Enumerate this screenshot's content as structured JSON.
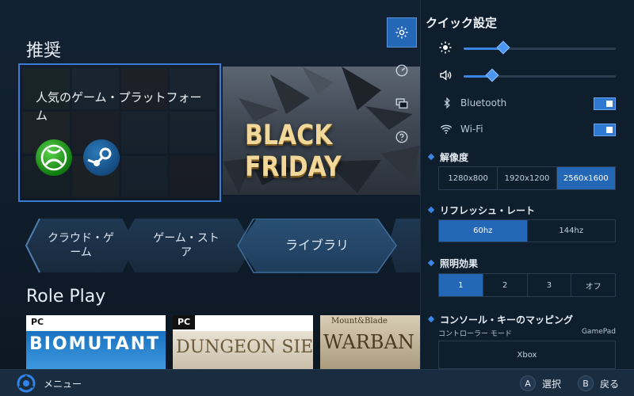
{
  "recommend": {
    "title": "推奨",
    "featured_title": "人気のゲーム・プラットフォーム",
    "banner_text": "BLACK FRIDAY"
  },
  "nav": {
    "cloud": "クラウド・ゲーム",
    "store": "ゲーム・ストア",
    "library": "ライブラリ"
  },
  "roleplay": {
    "title": "Role Play",
    "games": [
      {
        "badge": "PC",
        "title": "BIOMUTANT"
      },
      {
        "badge": "PC",
        "title": "DUNGEON SIEGE III"
      },
      {
        "badge": "",
        "title": "WARBAN",
        "sub": "Mount&Blade"
      }
    ]
  },
  "rail": {
    "items": [
      "settings-icon",
      "speed-icon",
      "windows-icon",
      "help-icon"
    ]
  },
  "quick_settings": {
    "title": "クイック設定",
    "brightness": {
      "value": 0.26
    },
    "volume": {
      "value": 0.19
    },
    "bluetooth": {
      "label": "Bluetooth",
      "on": true
    },
    "wifi": {
      "label": "Wi-Fi",
      "on": true
    },
    "resolution": {
      "label": "解像度",
      "options": [
        "1280x800",
        "1920x1200",
        "2560x1600"
      ],
      "selected": "2560x1600"
    },
    "refresh": {
      "label": "リフレッシュ・レート",
      "options": [
        "60hz",
        "144hz"
      ],
      "selected": "60hz"
    },
    "lighting": {
      "label": "照明効果",
      "options": [
        "1",
        "2",
        "3",
        "オフ"
      ],
      "selected": "1"
    },
    "mapping": {
      "label": "コンソール・キーのマッピング",
      "controller_mode_label": "コントローラー モード",
      "controller_mode_value": "GamePad",
      "current": "Xbox"
    }
  },
  "footer": {
    "menu": "メニュー",
    "select_key": "A",
    "select": "選択",
    "back_key": "B",
    "back": "戻る"
  },
  "colors": {
    "accent": "#2467b6",
    "background": "#0d1824",
    "panel": "#0f1e2d"
  }
}
